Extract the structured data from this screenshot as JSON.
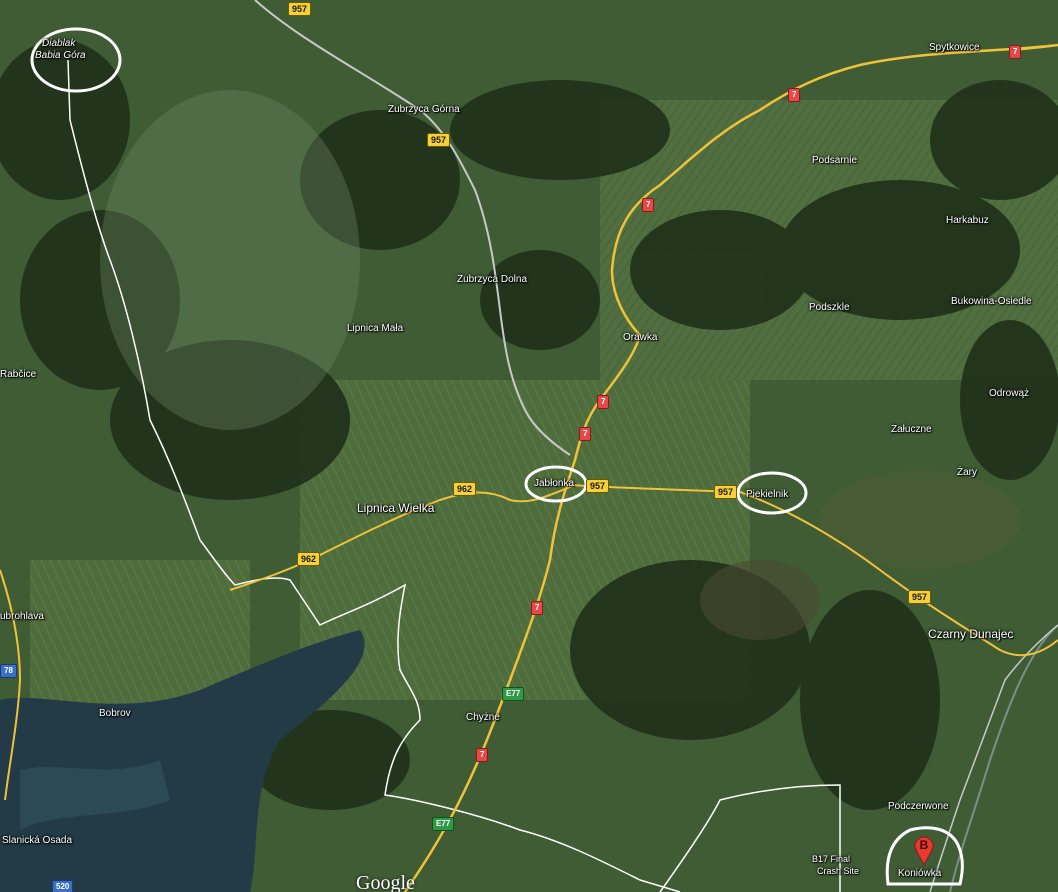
{
  "map": {
    "colors": {
      "forest": "#24391f",
      "meadow": "#4f6e3f",
      "water": "#213a44",
      "road_major": "#f0c23a",
      "border": "#ffffff"
    },
    "places": [
      {
        "id": "diablak",
        "name": "Diablak"
      },
      {
        "id": "babia-gora",
        "name": "Babia Góra"
      },
      {
        "id": "zubrzyca-gorna",
        "name": "Zubrzyca Górna"
      },
      {
        "id": "zubrzyca-dolna",
        "name": "Zubrzyca Dolna"
      },
      {
        "id": "lipnica-mala",
        "name": "Lipnica Mała"
      },
      {
        "id": "lipnica-wielka",
        "name": "Lipnica Wielka"
      },
      {
        "id": "rabcice",
        "name": "Rabčice"
      },
      {
        "id": "orawka",
        "name": "Orawka"
      },
      {
        "id": "jablonka",
        "name": "Jabłonka"
      },
      {
        "id": "piekielnik",
        "name": "Piekielnik"
      },
      {
        "id": "spytkowice",
        "name": "Spytkowice"
      },
      {
        "id": "podsarnie",
        "name": "Podsarnie"
      },
      {
        "id": "harkabuz",
        "name": "Harkabuz"
      },
      {
        "id": "podszkle",
        "name": "Podszkle"
      },
      {
        "id": "bukowina-osiedle",
        "name": "Bukowina-Osiedle"
      },
      {
        "id": "odrowaz",
        "name": "Odrowąż"
      },
      {
        "id": "zaluczne",
        "name": "Załuczne"
      },
      {
        "id": "zary",
        "name": "Żary"
      },
      {
        "id": "czarny-dunajec",
        "name": "Czarny Dunajec"
      },
      {
        "id": "ubrohlava",
        "name": "ubrohlava"
      },
      {
        "id": "bobrov",
        "name": "Bobrov"
      },
      {
        "id": "chyzne",
        "name": "Chyżne"
      },
      {
        "id": "slanicka-osada",
        "name": "Slanická Osada"
      },
      {
        "id": "podczerwone",
        "name": "Podczerwone"
      },
      {
        "id": "koniowka",
        "name": "Koniówka"
      },
      {
        "id": "b17-line1",
        "name": "B17 Final"
      },
      {
        "id": "b17-line2",
        "name": "Crash Site"
      }
    ],
    "shields": [
      {
        "id": "s957-top",
        "label": "957"
      },
      {
        "id": "s957-zub",
        "label": "957"
      },
      {
        "id": "s957-jab",
        "label": "957"
      },
      {
        "id": "s957-pie",
        "label": "957"
      },
      {
        "id": "s957-east",
        "label": "957"
      },
      {
        "id": "s962-a",
        "label": "962"
      },
      {
        "id": "s962-b",
        "label": "962"
      },
      {
        "id": "s7-spy",
        "label": "7"
      },
      {
        "id": "s7-a",
        "label": "7"
      },
      {
        "id": "s7-b",
        "label": "7"
      },
      {
        "id": "s7-c",
        "label": "7"
      },
      {
        "id": "s7-d",
        "label": "7"
      },
      {
        "id": "s7-e",
        "label": "7"
      },
      {
        "id": "s7-f",
        "label": "7"
      },
      {
        "id": "e77-a",
        "label": "E77"
      },
      {
        "id": "e77-b",
        "label": "E77"
      },
      {
        "id": "s78",
        "label": "78"
      },
      {
        "id": "s520",
        "label": "520"
      }
    ],
    "marker_letter": "B",
    "attribution": "Google"
  }
}
